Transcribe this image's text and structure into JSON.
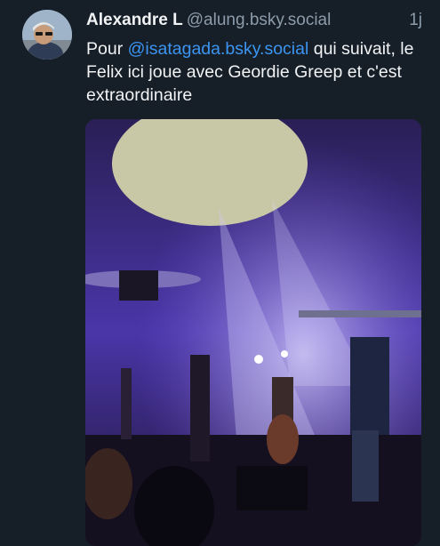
{
  "post": {
    "author": {
      "display_name": "Alexandre L",
      "handle": "@alung.bsky.social",
      "avatar_icon": "avatar-photo"
    },
    "time": "1j",
    "text": {
      "prefix": "Pour ",
      "mention": "@isatagada.bsky.social",
      "suffix": " qui suivait, le Felix ici joue avec Geordie Greep et c'est extraordinaire"
    },
    "media": {
      "type": "photo",
      "subject": "concert-stage-photo"
    }
  },
  "colors": {
    "background": "#161e27",
    "text": "#f1f3f5",
    "muted": "#8d9cab",
    "link": "#3c95f2"
  }
}
